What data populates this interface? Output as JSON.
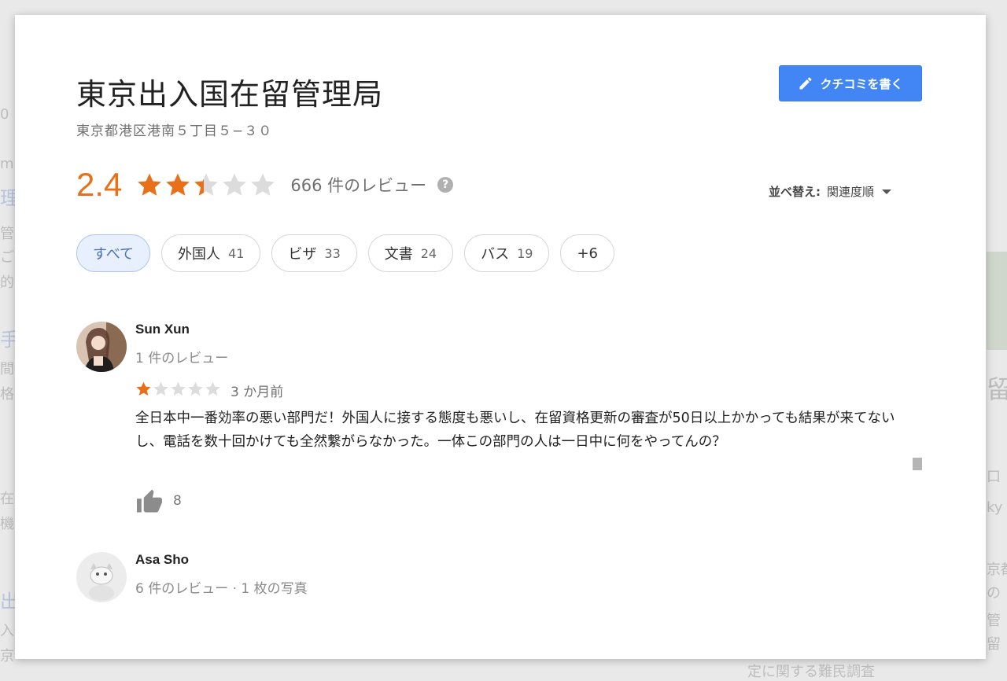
{
  "place": {
    "title": "東京出入国在留管理局",
    "address": "東京都港区港南５丁目５−３０",
    "write_review_label": "クチコミを書く"
  },
  "rating": {
    "score": "2.4",
    "stars_value": 2.4,
    "review_count": "666 件のレビュー",
    "star_color": "#e7711b"
  },
  "sort": {
    "label": "並べ替え:",
    "value": "関連度順"
  },
  "filters": [
    {
      "label": "すべて",
      "count": ""
    },
    {
      "label": "外国人",
      "count": "41"
    },
    {
      "label": "ビザ",
      "count": "33"
    },
    {
      "label": "文書",
      "count": "24"
    },
    {
      "label": "バス",
      "count": "19"
    },
    {
      "label": "+6",
      "count": ""
    }
  ],
  "reviews": [
    {
      "name": "Sun Xun",
      "meta": "1 件のレビュー",
      "stars": 1,
      "date": "3 か月前",
      "text": "全日本中一番効率の悪い部門だ！外国人に接する態度も悪いし、在留資格更新の審査が50日以上かかっても結果が来てないし、電話を数十回かけても全然繋がらなかった。一体この部門の人は一日中に何をやってんの？",
      "likes": "8"
    },
    {
      "name": "Asa Sho",
      "meta": "6 件のレビュー · 1 枚の写真"
    }
  ]
}
